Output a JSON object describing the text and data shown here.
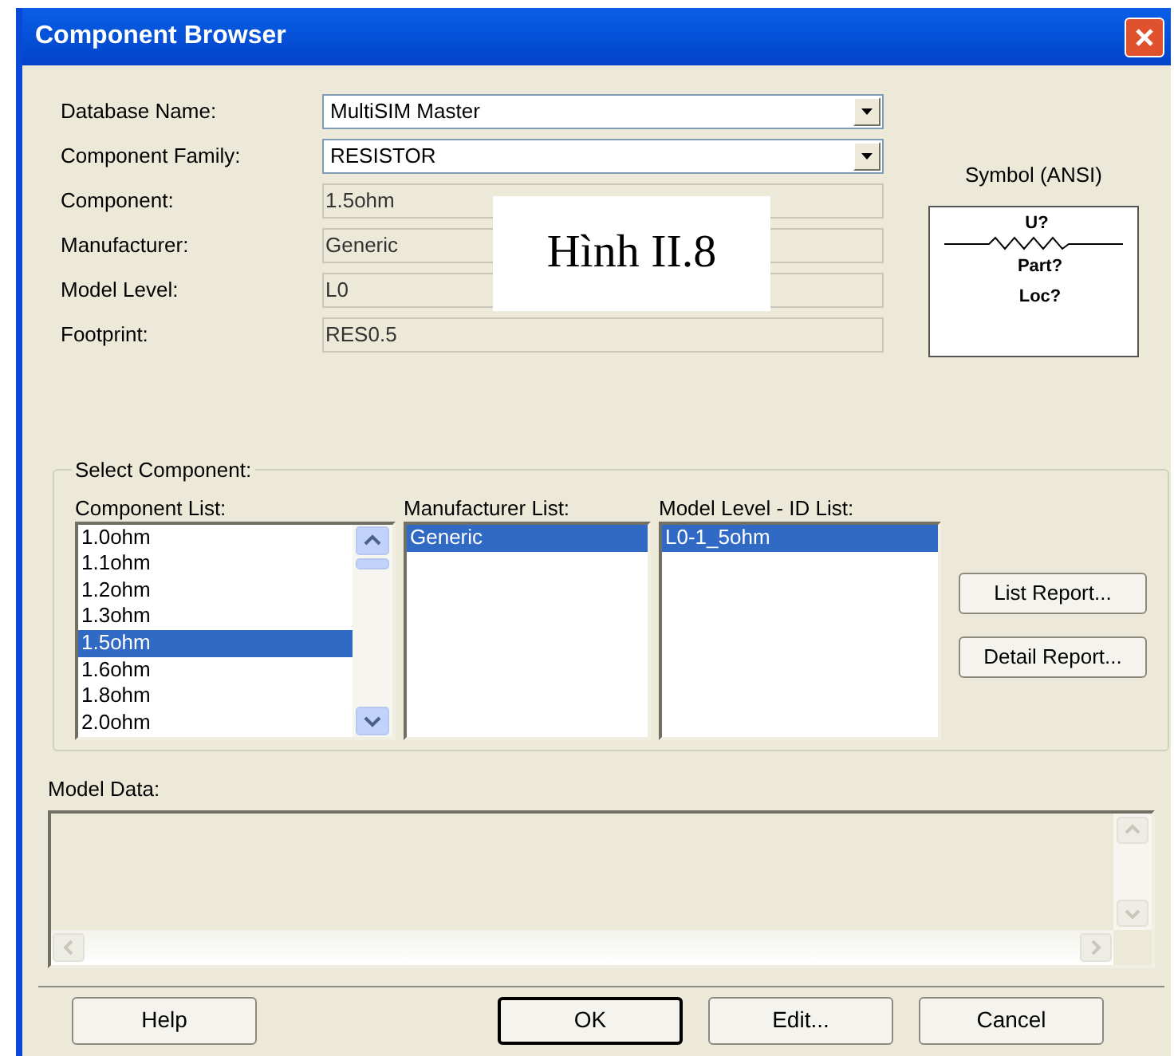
{
  "window": {
    "title": "Component Browser"
  },
  "caption": "Hình II.8",
  "fields": [
    {
      "label": "Database Name:",
      "value": "MultiSIM Master",
      "kind": "dropdown"
    },
    {
      "label": "Component Family:",
      "value": "RESISTOR",
      "kind": "dropdown"
    },
    {
      "label": "Component:",
      "value": "1.5ohm",
      "kind": "readonly"
    },
    {
      "label": "Manufacturer:",
      "value": "Generic",
      "kind": "readonly"
    },
    {
      "label": "Model Level:",
      "value": "L0",
      "kind": "readonly"
    },
    {
      "label": "Footprint:",
      "value": "RES0.5",
      "kind": "readonly"
    }
  ],
  "symbol": {
    "label": "Symbol (ANSI)",
    "ref": "U?",
    "part": "Part?",
    "loc": "Loc?"
  },
  "select_component": {
    "title": "Select Component:",
    "lists": [
      {
        "label": "Component List:",
        "kind": "scrolling",
        "items": [
          {
            "text": "1.0ohm",
            "selected": false
          },
          {
            "text": "1.1ohm",
            "selected": false
          },
          {
            "text": "1.2ohm",
            "selected": false
          },
          {
            "text": "1.3ohm",
            "selected": false
          },
          {
            "text": "1.5ohm",
            "selected": true
          },
          {
            "text": "1.6ohm",
            "selected": false
          },
          {
            "text": "1.8ohm",
            "selected": false
          },
          {
            "text": "2.0ohm",
            "selected": false
          }
        ]
      },
      {
        "label": "Manufacturer List:",
        "kind": "plain",
        "items": [
          {
            "text": "Generic",
            "selected": true
          }
        ]
      },
      {
        "label": "Model Level - ID List:",
        "kind": "plain",
        "items": [
          {
            "text": "L0-1_5ohm",
            "selected": true
          }
        ]
      }
    ],
    "buttons": [
      "List Report...",
      "Detail Report..."
    ]
  },
  "model_data": {
    "label": "Model Data:"
  },
  "buttons": [
    {
      "label": "Help",
      "default": false
    },
    {
      "label": "OK",
      "default": true
    },
    {
      "label": "Edit...",
      "default": false
    },
    {
      "label": "Cancel",
      "default": false
    }
  ]
}
